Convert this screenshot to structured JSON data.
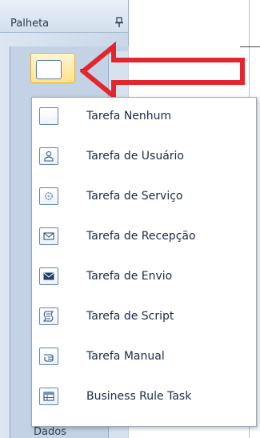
{
  "palette": {
    "title": "Palheta",
    "bottom_label": "Dados"
  },
  "menu": {
    "items": [
      {
        "label": "Tarefa Nenhum",
        "icon": "task-none-icon"
      },
      {
        "label": "Tarefa de Usuário",
        "icon": "user-icon"
      },
      {
        "label": "Tarefa de Serviço",
        "icon": "gear-icon"
      },
      {
        "label": "Tarefa de Recepção",
        "icon": "envelope-outline-icon"
      },
      {
        "label": "Tarefa de Envio",
        "icon": "envelope-filled-icon"
      },
      {
        "label": "Tarefa de Script",
        "icon": "script-icon"
      },
      {
        "label": "Tarefa Manual",
        "icon": "hand-icon"
      },
      {
        "label": "Business Rule Task",
        "icon": "table-icon"
      }
    ]
  },
  "colors": {
    "accent_arrow": "#e3262d",
    "selected_tool": "#ffe38a",
    "icon_border": "#5f84b8"
  }
}
